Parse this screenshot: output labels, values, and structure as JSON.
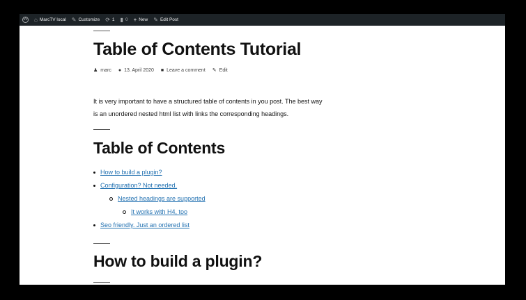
{
  "admin_bar": {
    "site_name": "MarcTV local",
    "customize": "Customize",
    "updates_count": "1",
    "comments_count": "0",
    "new": "New",
    "edit_post": "Edit Post"
  },
  "post": {
    "title": "Table of Contents Tutorial",
    "meta": {
      "author": "marc",
      "date": "13. April 2020",
      "comments": "Leave a comment",
      "edit": "Edit"
    },
    "intro_line1": "It is very important to have a structured table of contents in you post. The best way",
    "intro_line2": "is an unordered nested html list with links the corresponding headings.",
    "toc_heading": "Table of Contents",
    "toc": [
      {
        "label": "How to build a plugin?",
        "level": 1
      },
      {
        "label": "Configuration? Not needed.",
        "level": 1
      },
      {
        "label": "Nested headings are supported",
        "level": 2
      },
      {
        "label": "It works with H4, too",
        "level": 3
      },
      {
        "label": "Seo friendly. Just an ordered list",
        "level": 1
      }
    ],
    "section_heading": "How to build a plugin?"
  },
  "colors": {
    "admin_bar_bg": "#1d2327",
    "link": "#2271b1",
    "text": "#111111",
    "background": "#ffffff"
  }
}
